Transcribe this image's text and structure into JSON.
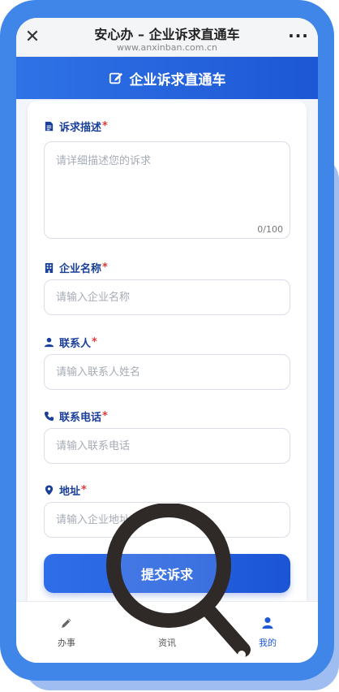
{
  "browser": {
    "title": "安心办 – 企业诉求直通车",
    "url": "www.anxinban.com.cn",
    "close_icon": "close-icon",
    "more_icon": "more-icon"
  },
  "header": {
    "title": "企业诉求直通车",
    "icon": "edit-icon"
  },
  "form": {
    "description": {
      "label": "诉求描述",
      "required": "*",
      "placeholder": "请详细描述您的诉求",
      "counter": "0/100",
      "icon": "document-icon"
    },
    "company": {
      "label": "企业名称",
      "required": "*",
      "placeholder": "请输入企业名称",
      "icon": "building-icon"
    },
    "contact": {
      "label": "联系人",
      "required": "*",
      "placeholder": "请输入联系人姓名",
      "icon": "user-icon"
    },
    "phone": {
      "label": "联系电话",
      "required": "*",
      "placeholder": "请输入联系电话",
      "icon": "phone-icon"
    },
    "address": {
      "label": "地址",
      "required": "*",
      "placeholder": "请输入企业地址",
      "icon": "location-pin-icon"
    },
    "submit_label": "提交诉求"
  },
  "tabbar": {
    "items": [
      {
        "label": "办事",
        "icon": "pencil-icon",
        "active": false
      },
      {
        "label": "资讯",
        "icon": "news-icon",
        "active": false
      },
      {
        "label": "我的",
        "icon": "user-icon",
        "active": true
      }
    ]
  },
  "colors": {
    "accent": "#1e5ad6",
    "frame": "#3f86e8",
    "required": "#e23a3a"
  }
}
